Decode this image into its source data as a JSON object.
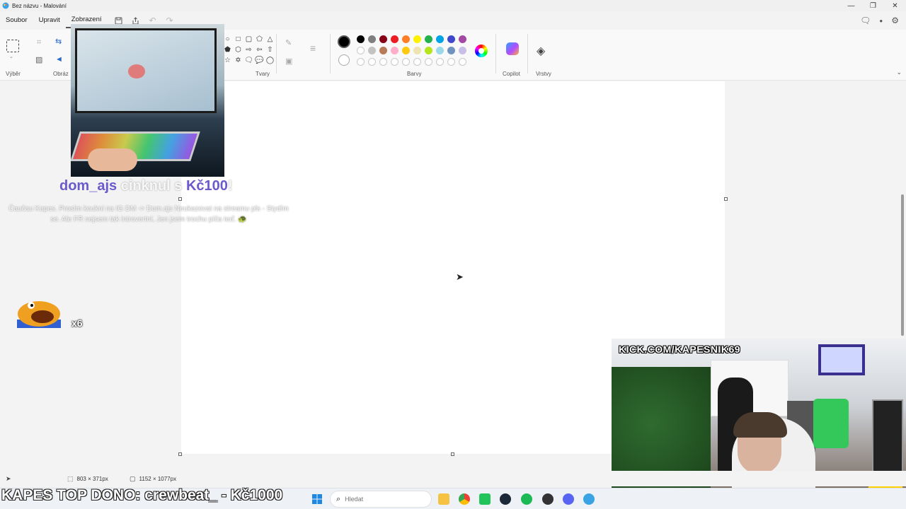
{
  "window": {
    "title": "Bez názvu - Malování",
    "controls": [
      "minimize",
      "restore",
      "close"
    ]
  },
  "menu": {
    "items": [
      "Soubor",
      "Upravit",
      "Zobrazení"
    ],
    "active": "Zobrazení",
    "quick_access": [
      "save-icon",
      "share-icon",
      "undo-icon",
      "redo-icon"
    ]
  },
  "ribbon": {
    "groups": {
      "select": "Výběr",
      "image": "Obráz",
      "shapes": "Tvary",
      "colors": "Barvy",
      "copilot": "Copilot",
      "layers": "Vrstvy"
    },
    "colors_row1": [
      "#000000",
      "#7f7f7f",
      "#880015",
      "#ed1c24",
      "#ff7f27",
      "#fff200",
      "#22b14c",
      "#00a2e8",
      "#3f48cc",
      "#a349a4"
    ],
    "colors_row2": [
      "#ffffff",
      "#c3c3c3",
      "#b97a57",
      "#ffaec9",
      "#ffc90e",
      "#efe4b0",
      "#b5e61d",
      "#99d9ea",
      "#7092be",
      "#c8bfe7"
    ],
    "primary_color": "#000000",
    "secondary_color": "#ffffff"
  },
  "overlay": {
    "donation": {
      "user": "dom_ajs",
      "action": "cinknul s",
      "amount": "Kč100",
      "suffix": "!",
      "message": "Čaučau Kapes. Prosím koukni na IG DM -> Dom.ajs Neukazovat na streamu pls - Stydím se. Ale FR nejsem tak introvertní, Jen jsem trochu píča teď. 🐢"
    },
    "emote_count": "x6",
    "kick_url": "KICK.COM/KAPESNIK69",
    "ticker": "KAPES TOP DONO: crewbeat_ - Kč1000"
  },
  "statusbar": {
    "selection_size": "803 × 371px",
    "canvas_size": "1152 × 1077px"
  },
  "taskbar": {
    "search_placeholder": "Hledat",
    "apps": [
      "start-icon",
      "file-explorer-icon",
      "chrome-icon",
      "xbox-icon",
      "steam-icon",
      "spotify-icon",
      "app-icon",
      "discord-icon",
      "paint-icon"
    ]
  }
}
